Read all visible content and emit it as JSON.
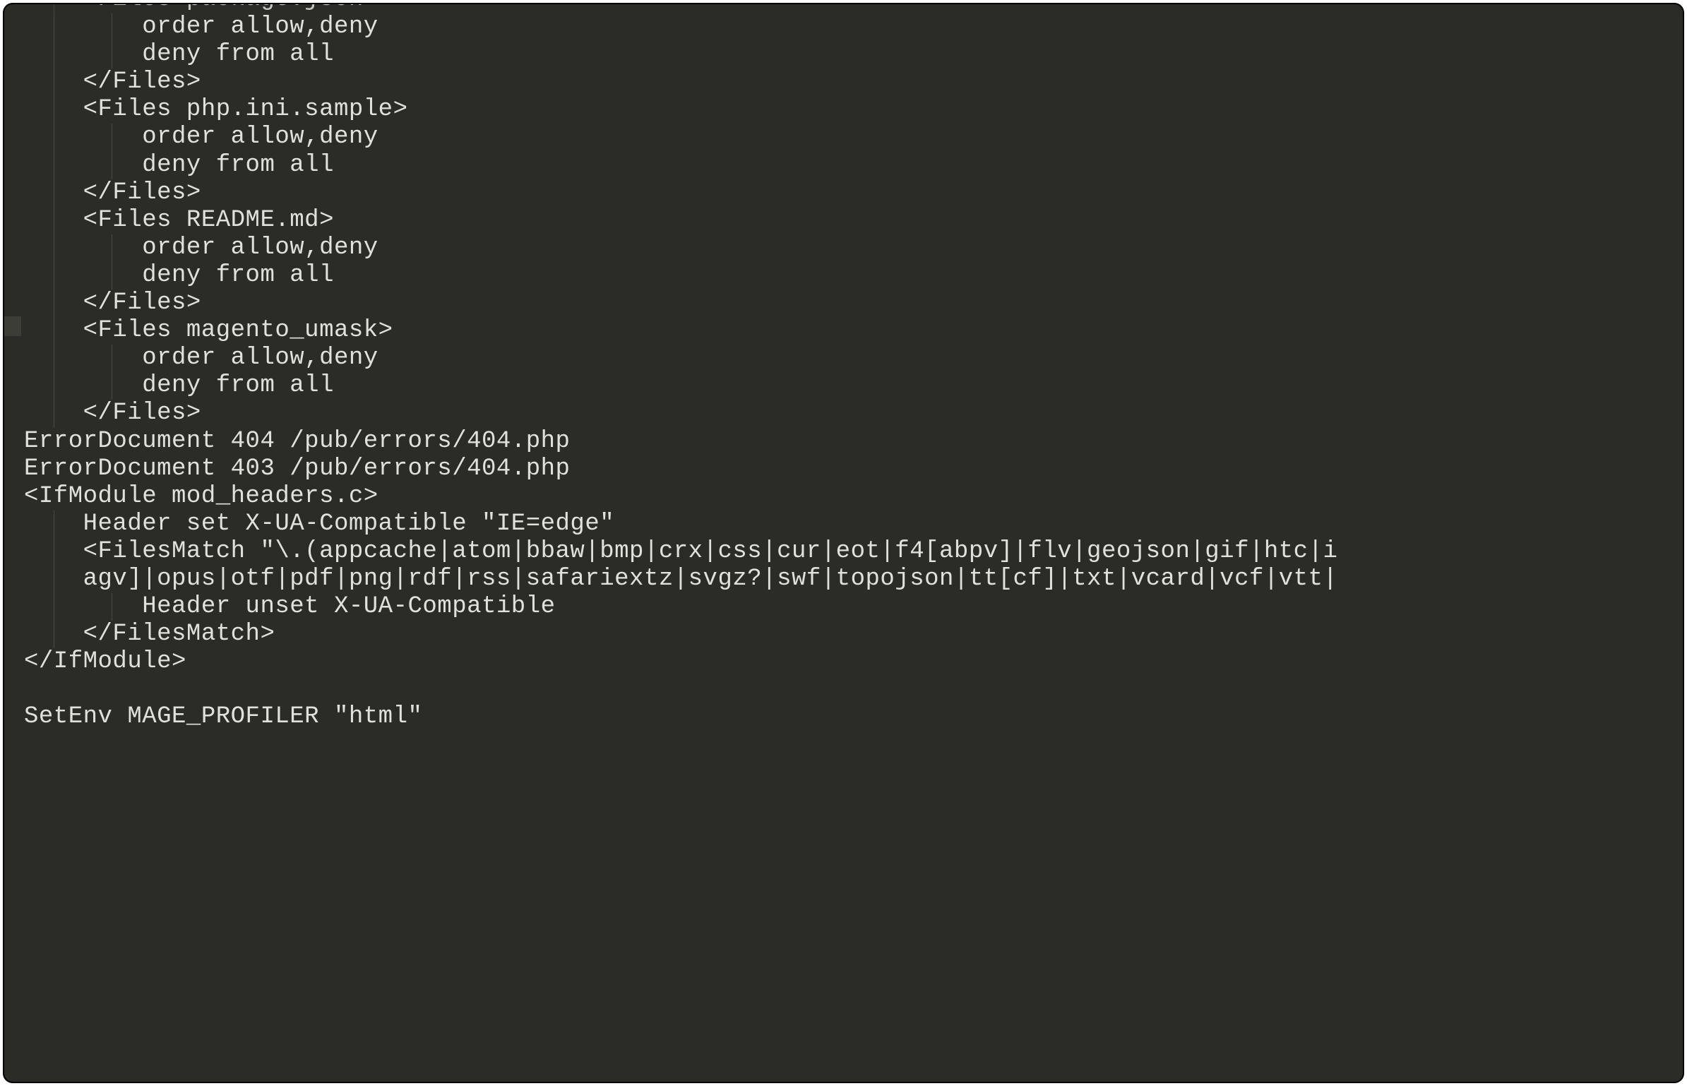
{
  "code": {
    "lines": [
      {
        "indent": 4,
        "text": "    <Files package.json>"
      },
      {
        "indent": 8,
        "text": "        order allow,deny"
      },
      {
        "indent": 8,
        "text": "        deny from all"
      },
      {
        "indent": 4,
        "text": "    </Files>"
      },
      {
        "indent": 4,
        "text": "    <Files php.ini.sample>"
      },
      {
        "indent": 8,
        "text": "        order allow,deny"
      },
      {
        "indent": 8,
        "text": "        deny from all"
      },
      {
        "indent": 4,
        "text": "    </Files>"
      },
      {
        "indent": 4,
        "text": "    <Files README.md>"
      },
      {
        "indent": 8,
        "text": "        order allow,deny"
      },
      {
        "indent": 8,
        "text": "        deny from all"
      },
      {
        "indent": 4,
        "text": "    </Files>"
      },
      {
        "indent": 4,
        "text": "    <Files magento_umask>"
      },
      {
        "indent": 8,
        "text": "        order allow,deny"
      },
      {
        "indent": 8,
        "text": "        deny from all"
      },
      {
        "indent": 4,
        "text": "    </Files>"
      },
      {
        "indent": 0,
        "text": "ErrorDocument 404 /pub/errors/404.php"
      },
      {
        "indent": 0,
        "text": "ErrorDocument 403 /pub/errors/404.php"
      },
      {
        "indent": 0,
        "text": "<IfModule mod_headers.c>"
      },
      {
        "indent": 4,
        "text": "    Header set X-UA-Compatible \"IE=edge\""
      },
      {
        "indent": 4,
        "text": "    <FilesMatch \"\\.(appcache|atom|bbaw|bmp|crx|css|cur|eot|f4[abpv]|flv|geojson|gif|htc|i"
      },
      {
        "indent": 4,
        "text": "    agv]|opus|otf|pdf|png|rdf|rss|safariextz|svgz?|swf|topojson|tt[cf]|txt|vcard|vcf|vtt|"
      },
      {
        "indent": 8,
        "text": "        Header unset X-UA-Compatible"
      },
      {
        "indent": 4,
        "text": "    </FilesMatch>"
      },
      {
        "indent": 0,
        "text": "</IfModule>"
      },
      {
        "indent": 0,
        "text": ""
      },
      {
        "indent": 0,
        "text": "SetEnv MAGE_PROFILER \"html\""
      }
    ]
  }
}
